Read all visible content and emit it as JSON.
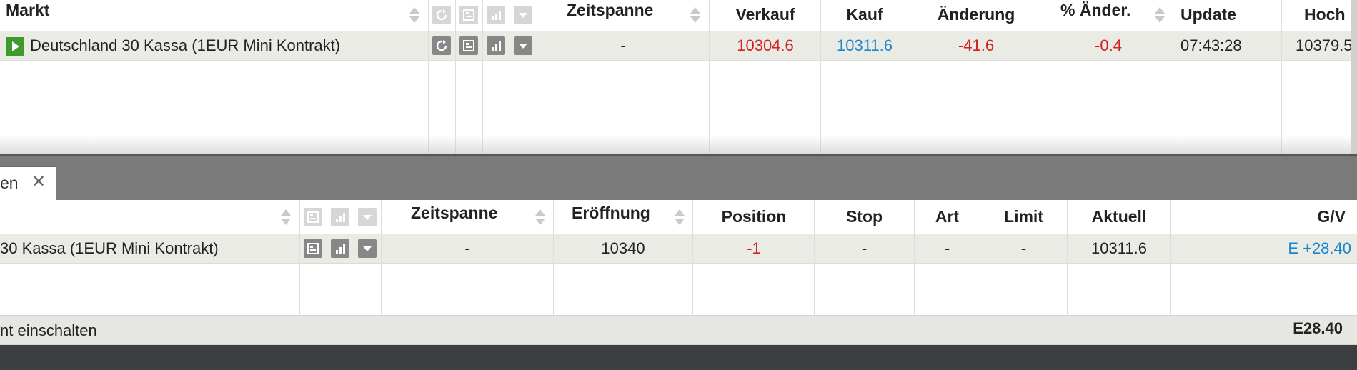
{
  "top_table": {
    "headers": {
      "market": "Markt",
      "timespan": "Zeitspanne",
      "sell": "Verkauf",
      "buy": "Kauf",
      "change": "Änderung",
      "pct_change": "% Änder.",
      "update": "Update",
      "high": "Hoch"
    },
    "row": {
      "market": "Deutschland 30 Kassa (1EUR Mini Kontrakt)",
      "timespan": "-",
      "sell": "10304.6",
      "buy": "10311.6",
      "change": "-41.6",
      "pct_change": "-0.4",
      "update": "07:43:28",
      "high": "10379.5"
    }
  },
  "tab": {
    "label": "en",
    "close": "✕"
  },
  "bottom_table": {
    "headers": {
      "timespan": "Zeitspanne",
      "opening": "Eröffnung",
      "position": "Position",
      "stop": "Stop",
      "type": "Art",
      "limit": "Limit",
      "current": "Aktuell",
      "pnl": "G/V"
    },
    "row": {
      "market": "30 Kassa (1EUR Mini Kontrakt)",
      "timespan": "-",
      "opening": "10340",
      "position": "-1",
      "stop": "-",
      "type": "-",
      "limit": "-",
      "current": "10311.6",
      "pnl": "E +28.40"
    }
  },
  "footer": {
    "left_text": "nt einschalten",
    "total": "E28.40"
  },
  "colors": {
    "negative": "#d0211c",
    "positive": "#1b86c8",
    "play_icon_bg": "#3f9a2e"
  },
  "icons": [
    "sort-icon",
    "refresh-icon",
    "info-sheet-icon",
    "chart-icon",
    "dropdown-icon",
    "play-icon",
    "close-icon"
  ]
}
